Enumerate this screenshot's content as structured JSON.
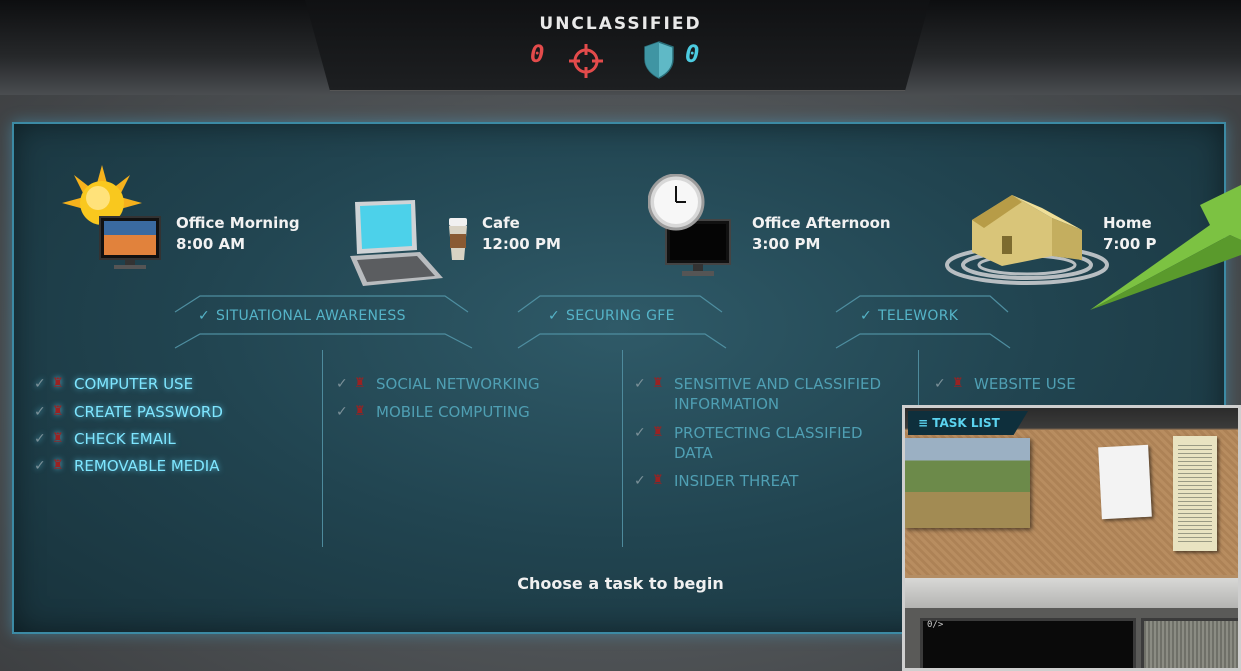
{
  "header": {
    "classification": "UNCLASSIFIED",
    "threat_count": "0",
    "defense_count": "0"
  },
  "locations": [
    {
      "name": "Office Morning",
      "time": "8:00 AM",
      "icon": "sun-monitor-icon"
    },
    {
      "name": "Cafe",
      "time": "12:00 PM",
      "icon": "laptop-coffee-icon"
    },
    {
      "name": "Office Afternoon",
      "time": "3:00 PM",
      "icon": "clock-monitor-icon"
    },
    {
      "name": "Home",
      "time": "7:00 P",
      "icon": "house-wifi-icon"
    }
  ],
  "categories": [
    {
      "label": "SITUATIONAL AWARENESS"
    },
    {
      "label": "SECURING GFE"
    },
    {
      "label": "TELEWORK"
    }
  ],
  "tasks": {
    "col1": [
      "COMPUTER USE",
      "CREATE PASSWORD",
      "CHECK EMAIL",
      "REMOVABLE MEDIA"
    ],
    "col2": [
      "SOCIAL NETWORKING",
      "MOBILE COMPUTING"
    ],
    "col3": [
      "SENSITIVE AND CLASSIFIED INFORMATION",
      "PROTECTING CLASSIFIED DATA",
      "INSIDER THREAT"
    ],
    "col4": [
      "WEBSITE USE"
    ]
  },
  "prompt": "Choose a task to begin",
  "inset": {
    "tab_label": "≡ TASK LIST",
    "terminal_prompt": "0/>"
  },
  "colors": {
    "accent": "#7fe6ff",
    "panel": "#214450",
    "threat": "#e34b4b",
    "defense": "#4ccbe0"
  }
}
